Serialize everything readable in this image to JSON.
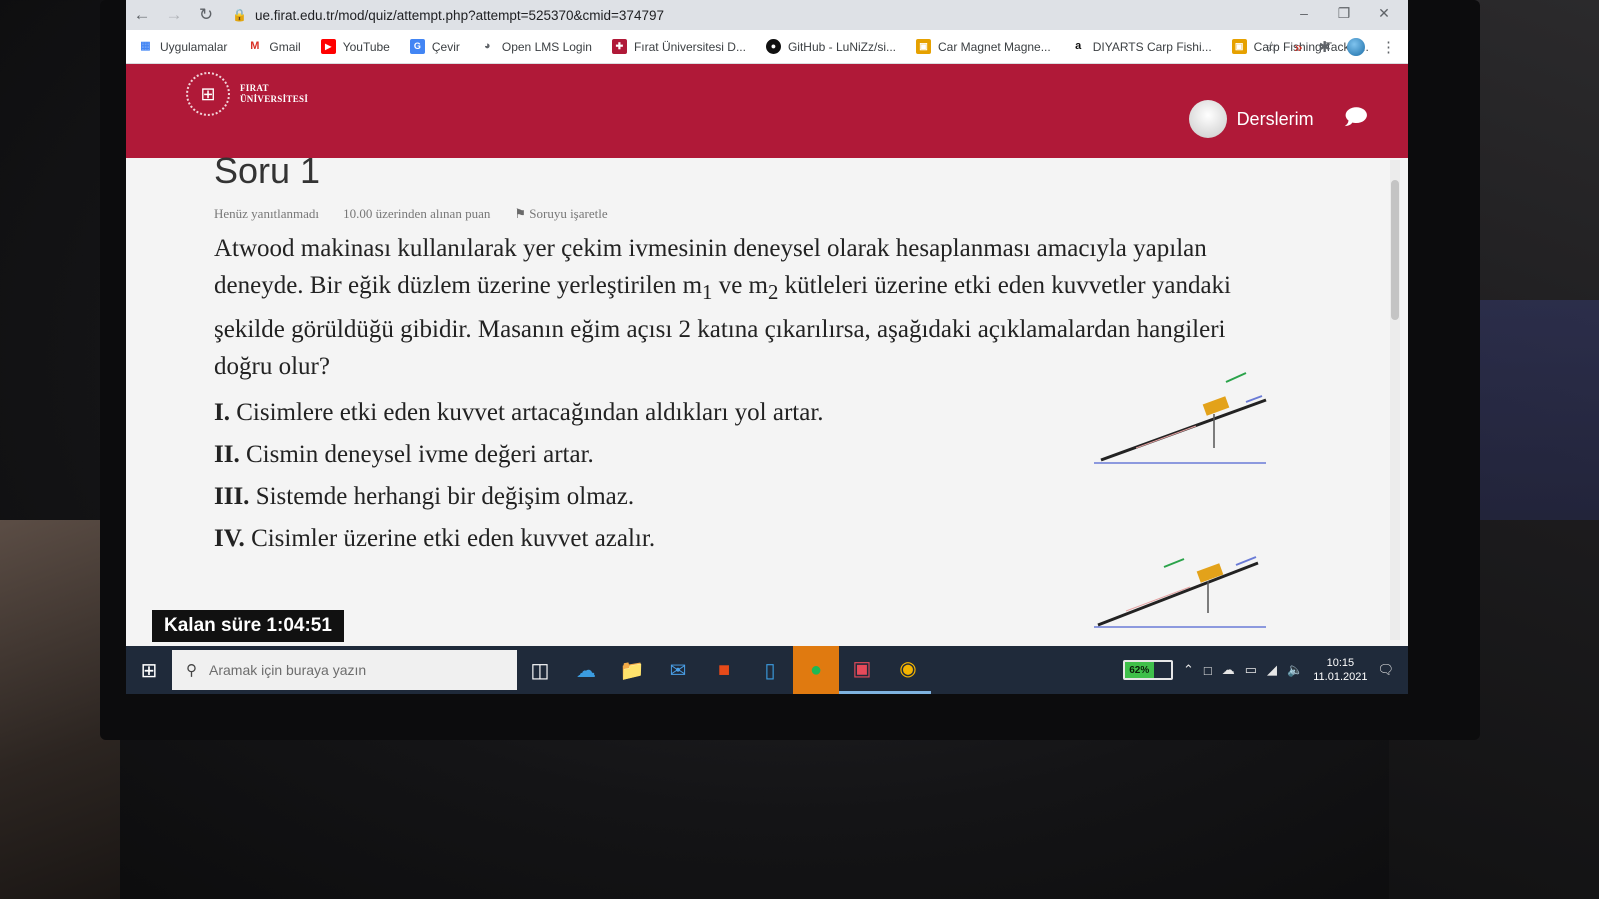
{
  "browser": {
    "url": "ue.firat.edu.tr/mod/quiz/attempt.php?attempt=525370&cmid=374797",
    "bookmarks": [
      {
        "label": "Uygulamalar",
        "icon": "apps-grid-icon",
        "color": "#4285f4"
      },
      {
        "label": "Gmail",
        "icon": "gmail-icon",
        "color": "#d93025"
      },
      {
        "label": "YouTube",
        "icon": "youtube-icon",
        "color": "#ff0000"
      },
      {
        "label": "Çevir",
        "icon": "translate-icon",
        "color": "#4285f4"
      },
      {
        "label": "Open LMS Login",
        "icon": "globe-icon",
        "color": "#5f6368"
      },
      {
        "label": "Fırat Üniversitesi D...",
        "icon": "firat-favicon-icon",
        "color": "#b01938"
      },
      {
        "label": "GitHub - LuNiZz/si...",
        "icon": "github-icon",
        "color": "#111111"
      },
      {
        "label": "Car Magnet Magne...",
        "icon": "shopping-bag-icon",
        "color": "#e6a100"
      },
      {
        "label": "DIYARTS Carp Fishi...",
        "icon": "amazon-icon",
        "color": "#111111"
      },
      {
        "label": "Carp Fishing Tackle...",
        "icon": "shopping-bag-icon",
        "color": "#e6a100"
      }
    ]
  },
  "navbar": {
    "logo_line1": "FIRAT",
    "logo_line2": "ÜNİVERSİTESİ",
    "user_menu_label": "Derslerim",
    "brand_color": "#b01938"
  },
  "question": {
    "title": "Soru 1",
    "status": "Henüz yanıtlanmadı",
    "points": "10.00 üzerinden alınan puan",
    "flag_label": "Soruyu işaretle",
    "text_part1": "Atwood makinası kullanılarak yer çekim ivmesinin deneysel olarak hesaplanması amacıyla yapılan deneyde. Bir eğik düzlem üzerine yerleştirilen m",
    "sub1": "1",
    "text_part2": " ve m",
    "sub2": "2",
    "text_part3": " kütleleri üzerine etki eden kuvvetler yandaki şekilde görüldüğü gibidir. Masanın eğim açısı 2 katına çıkarılırsa, aşağıdaki açıklamalardan hangileri doğru olur?",
    "statements": [
      {
        "num": "I.",
        "text": "Cisimlere etki eden kuvvet artacağından aldıkları yol artar."
      },
      {
        "num": "II.",
        "text": "Cismin deneysel ivme değeri artar."
      },
      {
        "num": "III.",
        "text": "Sistemde herhangi bir değişim olmaz."
      },
      {
        "num": "IV.",
        "text": "Cisimler üzerine etki eden kuvvet azalır."
      }
    ]
  },
  "timer": {
    "label": "Kalan süre 1:04:51"
  },
  "taskbar": {
    "search_placeholder": "Aramak için buraya yazın",
    "battery_percent": "62%",
    "battery_level": 0.62,
    "time": "10:15",
    "date": "11.01.2021"
  }
}
